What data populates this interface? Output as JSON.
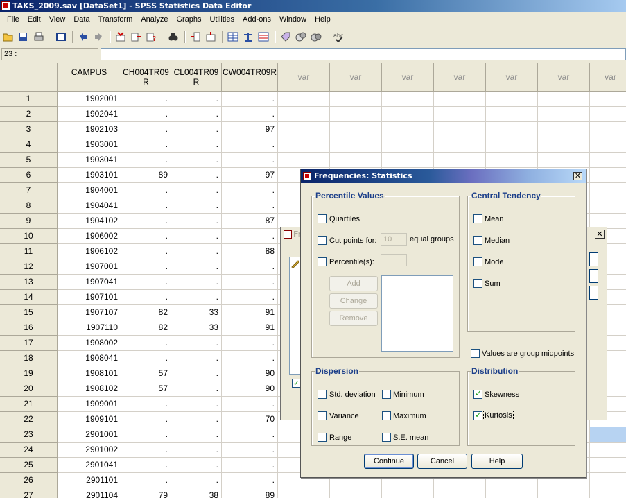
{
  "window": {
    "title": "TAKS_2009.sav [DataSet1] - SPSS Statistics Data Editor"
  },
  "menu": [
    "File",
    "Edit",
    "View",
    "Data",
    "Transform",
    "Analyze",
    "Graphs",
    "Utilities",
    "Add-ons",
    "Window",
    "Help"
  ],
  "toolbar": {
    "icons": [
      "open-icon",
      "save-icon",
      "print-icon",
      "dialog-recall-icon",
      "undo-icon",
      "redo-icon",
      "goto-case-icon",
      "goto-variable-icon",
      "variables-icon",
      "find-icon",
      "insert-cases-icon",
      "insert-variable-icon",
      "split-file-icon",
      "weight-cases-icon",
      "select-cases-icon",
      "value-labels-icon",
      "use-sets-icon",
      "show-all-variables-icon",
      "spelling-icon"
    ]
  },
  "cellref": {
    "label": "23 :",
    "value": ""
  },
  "grid": {
    "columns": [
      "CAMPUS",
      "CH004TR09\nR",
      "CL004TR09\nR",
      "CW004TR09R",
      "var",
      "var",
      "var",
      "var",
      "var",
      "var",
      "var"
    ],
    "rows": [
      [
        "1",
        "1902001",
        ".",
        ".",
        "."
      ],
      [
        "2",
        "1902041",
        ".",
        ".",
        "."
      ],
      [
        "3",
        "1902103",
        ".",
        ".",
        "97"
      ],
      [
        "4",
        "1903001",
        ".",
        ".",
        "."
      ],
      [
        "5",
        "1903041",
        ".",
        ".",
        "."
      ],
      [
        "6",
        "1903101",
        "89",
        ".",
        "97"
      ],
      [
        "7",
        "1904001",
        ".",
        ".",
        "."
      ],
      [
        "8",
        "1904041",
        ".",
        ".",
        "."
      ],
      [
        "9",
        "1904102",
        ".",
        ".",
        "87"
      ],
      [
        "10",
        "1906002",
        ".",
        ".",
        "."
      ],
      [
        "11",
        "1906102",
        ".",
        ".",
        "88"
      ],
      [
        "12",
        "1907001",
        ".",
        ".",
        "."
      ],
      [
        "13",
        "1907041",
        ".",
        ".",
        "."
      ],
      [
        "14",
        "1907101",
        ".",
        ".",
        "."
      ],
      [
        "15",
        "1907107",
        "82",
        "33",
        "91"
      ],
      [
        "16",
        "1907110",
        "82",
        "33",
        "91"
      ],
      [
        "17",
        "1908002",
        ".",
        ".",
        "."
      ],
      [
        "18",
        "1908041",
        ".",
        ".",
        "."
      ],
      [
        "19",
        "1908101",
        "57",
        ".",
        "90"
      ],
      [
        "20",
        "1908102",
        "57",
        ".",
        "90"
      ],
      [
        "21",
        "1909001",
        ".",
        ".",
        "."
      ],
      [
        "22",
        "1909101",
        ".",
        ".",
        "70"
      ],
      [
        "23",
        "2901001",
        ".",
        ".",
        "."
      ],
      [
        "24",
        "2901002",
        ".",
        ".",
        "."
      ],
      [
        "25",
        "2901041",
        ".",
        ".",
        "."
      ],
      [
        "26",
        "2901101",
        ".",
        ".",
        "."
      ],
      [
        "27",
        "2901104",
        "79",
        "38",
        "89"
      ]
    ],
    "selected_row": "23"
  },
  "dialog": {
    "title": "Frequencies: Statistics",
    "percentile": {
      "title": "Percentile Values",
      "quartiles": {
        "label": "Quartiles",
        "checked": false
      },
      "cut_points": {
        "label": "Cut points for:",
        "value": "10",
        "suffix": "equal groups",
        "checked": false
      },
      "percentiles": {
        "label": "Percentile(s):",
        "value": "",
        "checked": false
      },
      "add": "Add",
      "change": "Change",
      "remove": "Remove"
    },
    "central": {
      "title": "Central Tendency",
      "mean": {
        "label": "Mean",
        "checked": false
      },
      "median": {
        "label": "Median",
        "checked": false
      },
      "mode": {
        "label": "Mode",
        "checked": false
      },
      "sum": {
        "label": "Sum",
        "checked": false
      }
    },
    "group_midpoints": {
      "label": "Values are group midpoints",
      "checked": false
    },
    "dispersion": {
      "title": "Dispersion",
      "std": {
        "label": "Std. deviation",
        "checked": false
      },
      "minimum": {
        "label": "Minimum",
        "checked": false
      },
      "variance": {
        "label": "Variance",
        "checked": false
      },
      "maximum": {
        "label": "Maximum",
        "checked": false
      },
      "range": {
        "label": "Range",
        "checked": false
      },
      "se_mean": {
        "label": "S.E. mean",
        "checked": false
      }
    },
    "distribution": {
      "title": "Distribution",
      "skewness": {
        "label": "Skewness",
        "checked": true
      },
      "kurtosis": {
        "label": "Kurtosis",
        "checked": true
      }
    },
    "buttons": {
      "continue": "Continue",
      "cancel": "Cancel",
      "help": "Help"
    }
  },
  "bg_dialog": {
    "title_fragment": "Fr",
    "close": "✕"
  }
}
